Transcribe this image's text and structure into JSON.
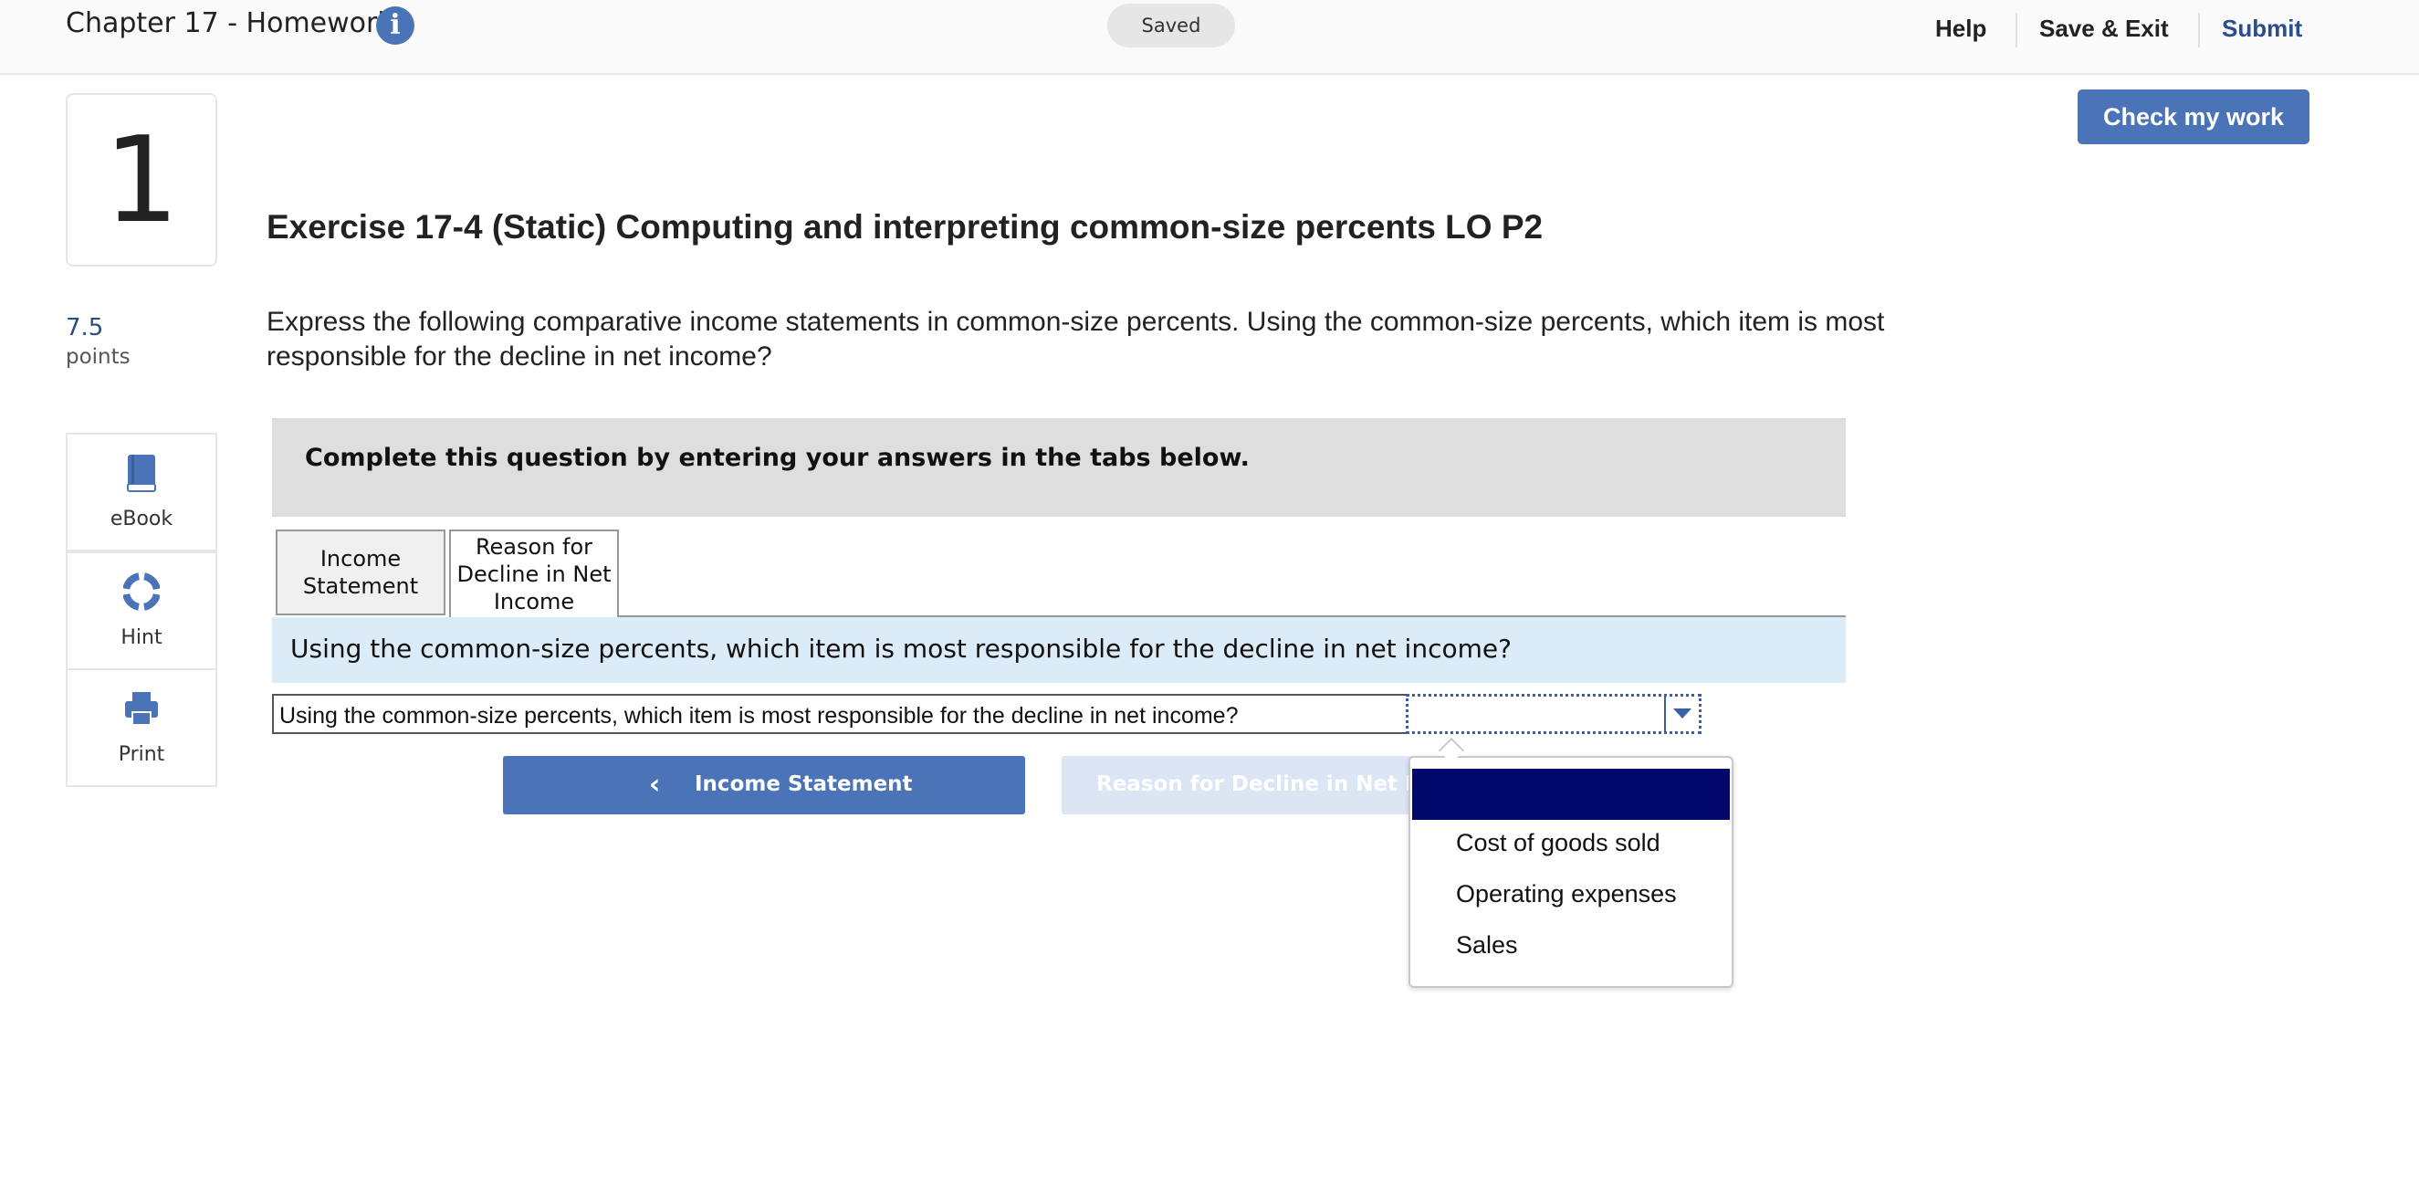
{
  "header": {
    "assignment_title": "Chapter 17 - Homework",
    "save_status": "Saved",
    "help_label": "Help",
    "save_exit_label": "Save & Exit",
    "submit_label": "Submit"
  },
  "question": {
    "number": "1",
    "points_value": "7.5",
    "points_label": "points",
    "title": "Exercise 17-4 (Static) Computing and interpreting common-size percents LO P2",
    "instructions": "Express the following comparative income statements in common-size percents. Using the common-size percents, which item is most responsible for the decline in net income?",
    "check_work_label": "Check my work"
  },
  "tools": [
    {
      "label": "eBook",
      "icon": "book-icon"
    },
    {
      "label": "Hint",
      "icon": "lifebuoy-icon"
    },
    {
      "label": "Print",
      "icon": "printer-icon"
    }
  ],
  "workspace": {
    "banner": "Complete this question by entering your answers in the tabs below.",
    "tabs": [
      {
        "label": "Income Statement",
        "active": false
      },
      {
        "label": "Reason for Decline in Net Income",
        "active": true
      }
    ],
    "prompt": "Using the common-size percents, which item is most responsible for the decline in net income?",
    "answer_label": "Using the common-size percents, which item is most responsible for the decline in net income?",
    "answer_value": "",
    "prev_button": "Income Statement",
    "next_button": "Reason for Decline in Net Income"
  },
  "dropdown": {
    "open": true,
    "options": [
      "",
      "Cost of goods sold",
      "Operating expenses",
      "Sales"
    ],
    "highlighted_index": 0
  },
  "colors": {
    "accent": "#4a74b7",
    "highlight": "#02076b",
    "prompt_bg": "#dcebf8"
  }
}
